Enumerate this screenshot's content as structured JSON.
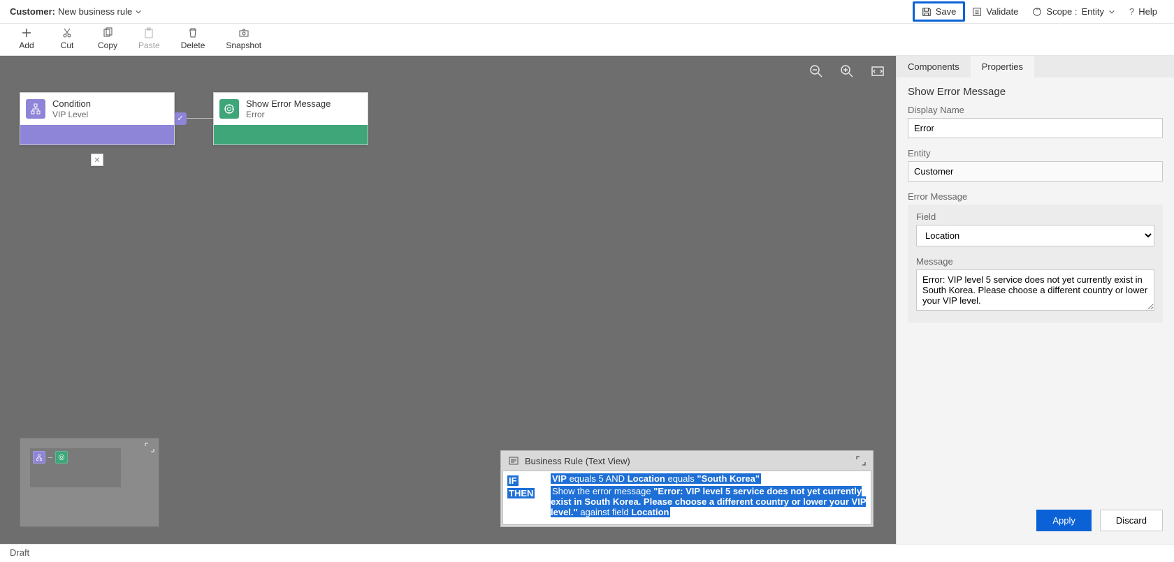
{
  "header": {
    "title_prefix": "Customer:",
    "title_name": "New business rule",
    "save": "Save",
    "validate": "Validate",
    "scope_label": "Scope :",
    "scope_value": "Entity",
    "help": "Help"
  },
  "toolbar": {
    "add": "Add",
    "cut": "Cut",
    "copy": "Copy",
    "paste": "Paste",
    "delete": "Delete",
    "snapshot": "Snapshot"
  },
  "canvas": {
    "condition_title": "Condition",
    "condition_sub": "VIP Level",
    "action_title": "Show Error Message",
    "action_sub": "Error"
  },
  "textview": {
    "title": "Business Rule (Text View)",
    "if": "IF",
    "then": "THEN",
    "cond_vip": "VIP",
    "cond_eq5": " equals 5 AND ",
    "cond_loc": "Location",
    "cond_eqk": " equals ",
    "cond_val": "\"South Korea\"",
    "then_pre": "Show the error message ",
    "then_msg": "\"Error: VIP level 5 service does not yet currently exist in South Korea. Please choose a different country or lower your VIP level.\"",
    "then_post": " against field ",
    "then_field": "Location"
  },
  "props": {
    "tab_components": "Components",
    "tab_properties": "Properties",
    "section": "Show Error Message",
    "display_name_label": "Display Name",
    "display_name_value": "Error",
    "entity_label": "Entity",
    "entity_value": "Customer",
    "error_msg_label": "Error Message",
    "field_label": "Field",
    "field_value": "Location",
    "message_label": "Message",
    "message_value": "Error: VIP level 5 service does not yet currently exist in South Korea. Please choose a different country or lower your VIP level.",
    "apply": "Apply",
    "discard": "Discard"
  },
  "status": "Draft"
}
